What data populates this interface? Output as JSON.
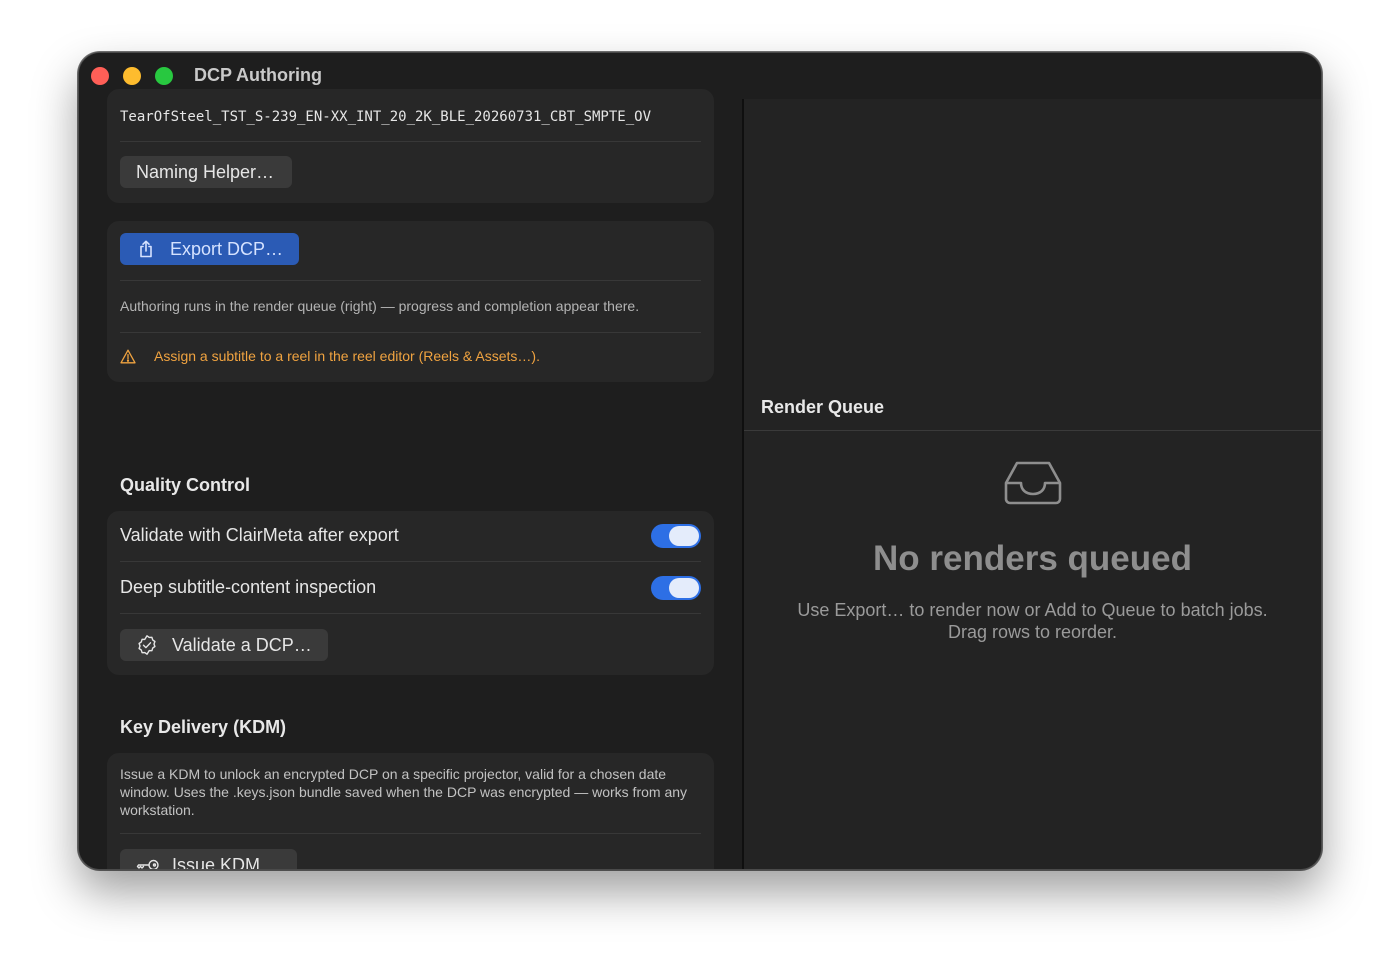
{
  "window": {
    "title": "DCP Authoring"
  },
  "naming": {
    "filename": "TearOfSteel_TST_S-239_EN-XX_INT_20_2K_BLE_20260731_CBT_SMPTE_OV",
    "helper_button": "Naming Helper…"
  },
  "export": {
    "button": "Export DCP…",
    "icon": "share-icon",
    "note": "Authoring runs in the render queue (right) — progress and completion appear there.",
    "warning": "Assign a subtitle to a reel in the reel editor (Reels & Assets…).",
    "warning_color": "#f0a340"
  },
  "quality": {
    "title": "Quality Control",
    "options": [
      {
        "label": "Validate with ClairMeta after export",
        "enabled": true
      },
      {
        "label": "Deep subtitle-content inspection",
        "enabled": true
      }
    ],
    "validate_button": "Validate a DCP…"
  },
  "kdm": {
    "title": "Key Delivery (KDM)",
    "description": "Issue a KDM to unlock an encrypted DCP on a specific projector, valid for a chosen date window. Uses the .keys.json bundle saved when the DCP was encrypted — works from any workstation.",
    "button": "Issue KDM…"
  },
  "render_queue": {
    "title": "Render Queue",
    "icon": "tray-icon",
    "empty_title": "No renders queued",
    "empty_line1": "Use Export… to render now or Add to Queue to batch jobs.",
    "empty_line2": "Drag rows to reorder."
  },
  "colors": {
    "accent": "#2d6fe5",
    "primary_button": "#2b5bb5"
  }
}
